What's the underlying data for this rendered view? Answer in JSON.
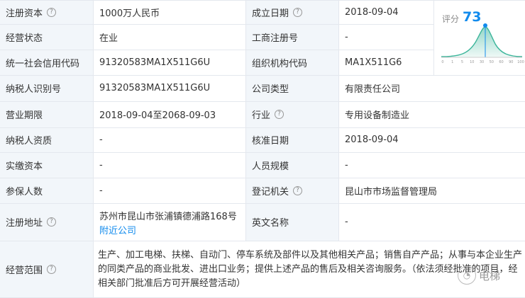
{
  "rows": [
    {
      "l1": "注册资本",
      "v1": "1000万人民币",
      "l2": "成立日期",
      "v2": "2018-09-04"
    },
    {
      "l1": "经营状态",
      "v1": "在业",
      "l2": "工商注册号",
      "v2": "-"
    },
    {
      "l1": "统一社会信用代码",
      "v1": "91320583MA1X511G6U",
      "l2": "组织机构代码",
      "v2": "MA1X511G6"
    },
    {
      "l1": "纳税人识别号",
      "v1": "91320583MA1X511G6U",
      "l2": "公司类型",
      "v2": "有限责任公司"
    },
    {
      "l1": "营业期限",
      "v1": "2018-09-04至2068-09-03",
      "l2": "行业",
      "v2": "专用设备制造业"
    },
    {
      "l1": "纳税人资质",
      "v1": "-",
      "l2": "核准日期",
      "v2": "2018-09-04"
    },
    {
      "l1": "实缴资本",
      "v1": "-",
      "l2": "人员规模",
      "v2": "-"
    },
    {
      "l1": "参保人数",
      "v1": "-",
      "l2": "登记机关",
      "v2": "昆山市市场监督管理局"
    },
    {
      "l1": "注册地址",
      "v1": "苏州市昆山市张浦镇德浦路168号",
      "link": "附近公司",
      "l2": "英文名称",
      "v2": "-"
    }
  ],
  "scope": {
    "label": "经营范围",
    "text": "生产、加工电梯、扶梯、自动门、停车系统及部件以及其他相关产品；销售自产产品；从事与本企业生产的同类产品的商业批发、进出口业务；提供上述产品的售后及相关咨询服务。（依法须经批准的项目，经相关部门批准后方可开展经营活动）"
  },
  "score": {
    "label": "评分",
    "value": "73",
    "ticks": [
      "0",
      "1",
      "5",
      "10",
      "30",
      "50",
      "60",
      "90",
      "100"
    ]
  },
  "watermark": {
    "text": "电梯"
  },
  "colors": {
    "accent": "#128bed",
    "label_bg": "#f2f6fa",
    "border": "#e4e8ee"
  }
}
